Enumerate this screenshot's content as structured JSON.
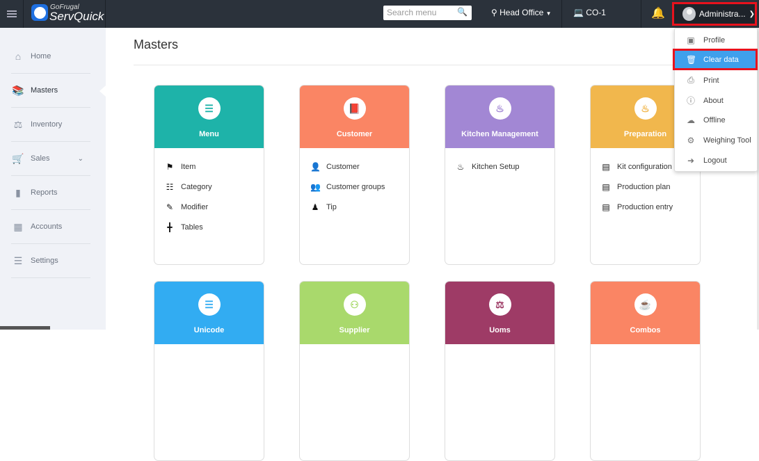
{
  "topbar": {
    "brand_top": "GoFrugal",
    "brand": "ServQuick",
    "search_placeholder": "Search menu",
    "location": "Head Office",
    "counter": "CO-1",
    "user": "Administra..."
  },
  "sidebar": {
    "items": [
      {
        "label": "Home",
        "icon": "home-icon"
      },
      {
        "label": "Masters",
        "icon": "book-icon"
      },
      {
        "label": "Inventory",
        "icon": "trolley-icon"
      },
      {
        "label": "Sales",
        "icon": "cart-icon"
      },
      {
        "label": "Reports",
        "icon": "signal-icon"
      },
      {
        "label": "Accounts",
        "icon": "calculator-icon"
      },
      {
        "label": "Settings",
        "icon": "sliders-icon"
      }
    ]
  },
  "page": {
    "title": "Masters"
  },
  "cards": [
    {
      "title": "Menu",
      "color": "#1eb3a9",
      "items": [
        "Item",
        "Category",
        "Modifier",
        "Tables"
      ]
    },
    {
      "title": "Customer",
      "color": "#fa8564",
      "items": [
        "Customer",
        "Customer groups",
        "Tip"
      ]
    },
    {
      "title": "Kitchen Management",
      "color": "#a287d4",
      "items": [
        "Kitchen Setup"
      ]
    },
    {
      "title": "Preparation",
      "color": "#f1b74d",
      "items": [
        "Kit configuration",
        "Production plan",
        "Production entry"
      ]
    },
    {
      "title": "Unicode",
      "color": "#32acf2",
      "items": []
    },
    {
      "title": "Supplier",
      "color": "#a9d96c",
      "items": []
    },
    {
      "title": "Uoms",
      "color": "#9e3b66",
      "items": []
    },
    {
      "title": "Combos",
      "color": "#fa8564",
      "items": []
    }
  ],
  "user_menu": {
    "items": [
      "Profile",
      "Clear data",
      "Print",
      "About",
      "Offline",
      "Weighing Tool",
      "Logout"
    ],
    "highlighted": "Clear data"
  }
}
